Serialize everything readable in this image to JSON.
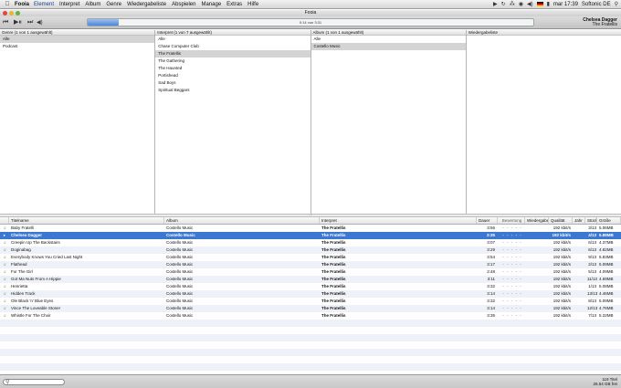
{
  "menubar": {
    "apple": "",
    "app_name": "Fooia",
    "items": [
      "Element",
      "Interpret",
      "Album",
      "Genre",
      "Wiedergabeliste",
      "Abspielen",
      "Manage",
      "Extras",
      "Hilfe"
    ],
    "clock": "mar 17:39",
    "user": "Softonic DE"
  },
  "window": {
    "title": "Fooia"
  },
  "toolbar": {
    "prev": "⏮",
    "play_pause": "▶⏸",
    "next": "⏭",
    "volume": "◀)",
    "progress_text": "0:14 von 3:31",
    "progress_fraction": 0.07,
    "now_playing_title": "Chelsea Dagger",
    "now_playing_artist": "The Fratellis"
  },
  "browser": {
    "genre": {
      "header": "Genre (1 von 1 ausgewählt)",
      "items": [
        "Alle",
        "Podcast"
      ],
      "selected": 0
    },
    "artist": {
      "header": "Interpret (1 von 7 ausgewählt)",
      "items": [
        "Alle",
        "Chase Computer Club",
        "The Fratellis",
        "The Gathering",
        "The Haunted",
        "Portishead",
        "Sad Boys",
        "Spiritual Beggars"
      ],
      "selected": 2
    },
    "album": {
      "header": "Album (1 von 1 ausgewählt)",
      "items": [
        "Alle",
        "Costello Music"
      ],
      "selected": 1
    },
    "playlist": {
      "header": "Wiedergabeliste",
      "items": []
    }
  },
  "table": {
    "columns": {
      "title": "Titelname",
      "album": "Album",
      "artist": "Interpret",
      "duration": "Dauer",
      "rating": "Bewertung",
      "plays": "Wiedergabe...",
      "quality": "Qualität",
      "year": "Jahr",
      "track": "Stück",
      "size": "Größe"
    },
    "rows": [
      {
        "title": "Baby Fratelli",
        "album": "Costello Music",
        "artist": "The Fratellis",
        "duration": "3:56",
        "rating": "- - - - -",
        "quality": "192 kbit/s",
        "track": "3/13",
        "size": "5.06MB"
      },
      {
        "title": "Chelsea Dagger",
        "album": "Costello Music",
        "artist": "The Fratellis",
        "duration": "3:35",
        "rating": "- - - - -",
        "quality": "192 kbit/s",
        "track": "4/13",
        "size": "5.88MB",
        "selected": true
      },
      {
        "title": "Creepin Up The Backstairs",
        "album": "Costello Music",
        "artist": "The Fratellis",
        "duration": "3:07",
        "rating": "- - - - -",
        "quality": "192 kbit/s",
        "track": "6/13",
        "size": "4.37MB"
      },
      {
        "title": "Doginabag",
        "album": "Costello Music",
        "artist": "The Fratellis",
        "duration": "3:29",
        "rating": "- - - - -",
        "quality": "192 kbit/s",
        "track": "6/13",
        "size": "4.82MB"
      },
      {
        "title": "Everybody Knows You Cried Last Night",
        "album": "Costello Music",
        "artist": "The Fratellis",
        "duration": "3:54",
        "rating": "- - - - -",
        "quality": "192 kbit/s",
        "track": "9/13",
        "size": "5.83MB"
      },
      {
        "title": "Flathead",
        "album": "Costello Music",
        "artist": "The Fratellis",
        "duration": "3:17",
        "rating": "- - - - -",
        "quality": "192 kbit/s",
        "track": "2/13",
        "size": "5.09MB"
      },
      {
        "title": "For The Girl",
        "album": "Costello Music",
        "artist": "The Fratellis",
        "duration": "2:48",
        "rating": "- - - - -",
        "quality": "192 kbit/s",
        "track": "5/13",
        "size": "4.09MB"
      },
      {
        "title": "Got Ma Nuts From A Hippie",
        "album": "Costello Music",
        "artist": "The Fratellis",
        "duration": "3:11",
        "rating": "- - - - -",
        "quality": "192 kbit/s",
        "track": "11/13",
        "size": "4.69MB"
      },
      {
        "title": "Henrietta",
        "album": "Costello Music",
        "artist": "The Fratellis",
        "duration": "3:32",
        "rating": "- - - - -",
        "quality": "192 kbit/s",
        "track": "1/13",
        "size": "5.08MB"
      },
      {
        "title": "Hidden Track",
        "album": "Costello Music",
        "artist": "The Fratellis",
        "duration": "3:14",
        "rating": "- - - - -",
        "quality": "192 kbit/s",
        "track": "13/13",
        "size": "4.46MB"
      },
      {
        "title": "Ole Black 'n' Blue Eyes",
        "album": "Costello Music",
        "artist": "The Fratellis",
        "duration": "3:32",
        "rating": "- - - - -",
        "quality": "192 kbit/s",
        "track": "8/13",
        "size": "5.09MB"
      },
      {
        "title": "Vince The Loveable Stoner",
        "album": "Costello Music",
        "artist": "The Fratellis",
        "duration": "3:14",
        "rating": "- - - - -",
        "quality": "192 kbit/s",
        "track": "12/13",
        "size": "4.76MB"
      },
      {
        "title": "Whistle For The Choir",
        "album": "Costello Music",
        "artist": "The Fratellis",
        "duration": "3:35",
        "rating": "- - - - -",
        "quality": "192 kbit/s",
        "track": "7/13",
        "size": "5.22MB"
      }
    ]
  },
  "status": {
    "search_placeholder": "",
    "total_titles": "119 Titel",
    "total_size": "26.54 GB frei"
  },
  "colors": {
    "selection": "#3c78d2",
    "progress": "#4e86d8",
    "alt_row": "#eef2f8"
  }
}
